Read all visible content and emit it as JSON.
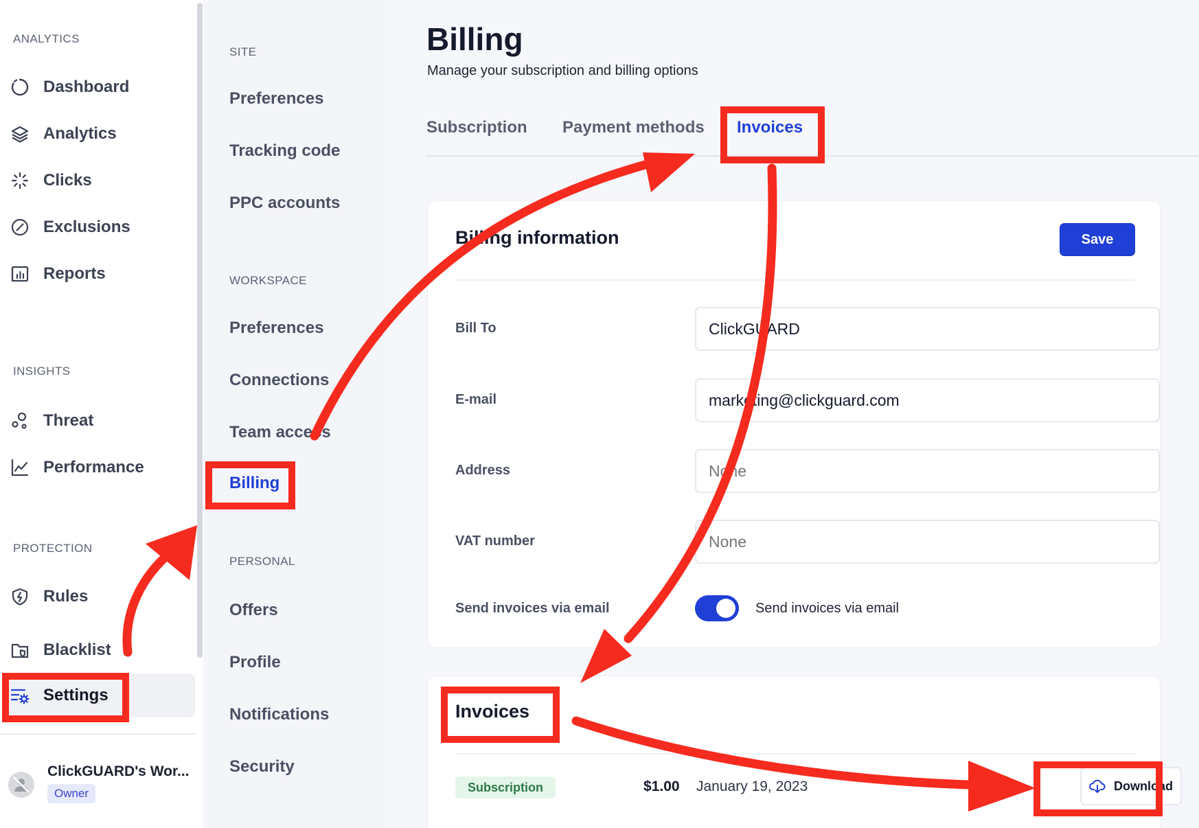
{
  "sidebar": {
    "sections": {
      "analytics": "ANALYTICS",
      "insights": "INSIGHTS",
      "protection": "PROTECTION"
    },
    "items": [
      {
        "label": "Dashboard",
        "icon": "dashboard-icon"
      },
      {
        "label": "Analytics",
        "icon": "layers-icon"
      },
      {
        "label": "Clicks",
        "icon": "clicks-icon"
      },
      {
        "label": "Exclusions",
        "icon": "exclusions-icon"
      },
      {
        "label": "Reports",
        "icon": "reports-icon"
      },
      {
        "label": "Threat",
        "icon": "threat-icon"
      },
      {
        "label": "Performance",
        "icon": "performance-icon"
      },
      {
        "label": "Rules",
        "icon": "shield-icon"
      },
      {
        "label": "Blacklist",
        "icon": "blacklist-icon"
      },
      {
        "label": "Settings",
        "icon": "settings-icon",
        "active": true
      }
    ],
    "workspace": {
      "name": "ClickGUARD's Wor...",
      "role": "Owner"
    }
  },
  "settings_nav": {
    "sections": {
      "site": "SITE",
      "workspace": "WORKSPACE",
      "personal": "PERSONAL"
    },
    "items": [
      {
        "label": "Preferences"
      },
      {
        "label": "Tracking code"
      },
      {
        "label": "PPC accounts"
      },
      {
        "label": "Preferences"
      },
      {
        "label": "Connections"
      },
      {
        "label": "Team access"
      },
      {
        "label": "Billing",
        "active": true
      },
      {
        "label": "Offers"
      },
      {
        "label": "Profile"
      },
      {
        "label": "Notifications"
      },
      {
        "label": "Security"
      }
    ]
  },
  "page": {
    "title": "Billing",
    "subtitle": "Manage your subscription and billing options"
  },
  "tabs": [
    {
      "label": "Subscription"
    },
    {
      "label": "Payment methods"
    },
    {
      "label": "Invoices",
      "active": true
    }
  ],
  "billing_info": {
    "title": "Billing information",
    "save_label": "Save",
    "fields": {
      "bill_to": {
        "label": "Bill To",
        "value": "ClickGUARD"
      },
      "email": {
        "label": "E-mail",
        "value": "marketing@clickguard.com"
      },
      "address": {
        "label": "Address",
        "placeholder": "None"
      },
      "vat": {
        "label": "VAT number",
        "placeholder": "None"
      }
    },
    "send_invoices": {
      "label": "Send invoices via email",
      "toggle_label": "Send invoices via email",
      "enabled": true
    }
  },
  "invoices": {
    "title": "Invoices",
    "rows": [
      {
        "type": "Subscription",
        "amount": "$1.00",
        "date": "January 19, 2023",
        "action": "Download"
      }
    ]
  },
  "colors": {
    "accent": "#1f3fd6",
    "annotation": "#f62b1f",
    "badge_bg": "#e4f5ea",
    "badge_text": "#2d7a48"
  }
}
